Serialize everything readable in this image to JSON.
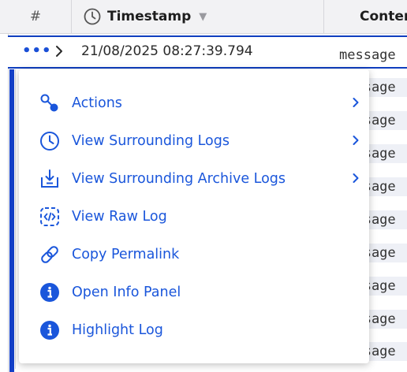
{
  "header": {
    "index_label": "#",
    "timestamp_label": "Timestamp",
    "content_label": "Content"
  },
  "selected_row": {
    "timestamp": "21/08/2025 08:27:39.794",
    "message_preview": "message"
  },
  "background_rows": [
    {
      "message_preview": "message"
    },
    {
      "message_preview": "message"
    },
    {
      "message_preview": "message"
    },
    {
      "message_preview": "message"
    },
    {
      "message_preview": "message"
    },
    {
      "message_preview": "message"
    },
    {
      "message_preview": "message"
    },
    {
      "message_preview": "message"
    },
    {
      "message_preview": "message"
    }
  ],
  "context_menu": {
    "items": [
      {
        "label": "Actions",
        "icon": "actions-icon",
        "has_submenu": true
      },
      {
        "label": "View Surrounding Logs",
        "icon": "clock-icon",
        "has_submenu": true
      },
      {
        "label": "View Surrounding Archive Logs",
        "icon": "archive-download-icon",
        "has_submenu": true
      },
      {
        "label": "View Raw Log",
        "icon": "code-icon",
        "has_submenu": false
      },
      {
        "label": "Copy Permalink",
        "icon": "link-icon",
        "has_submenu": false
      },
      {
        "label": "Open Info Panel",
        "icon": "info-icon",
        "has_submenu": false
      },
      {
        "label": "Highlight Log",
        "icon": "info-icon",
        "has_submenu": false
      }
    ]
  },
  "colors": {
    "accent": "#1a56db",
    "selection_border": "#0f3ebf",
    "header_bg": "#f2f2f4"
  }
}
